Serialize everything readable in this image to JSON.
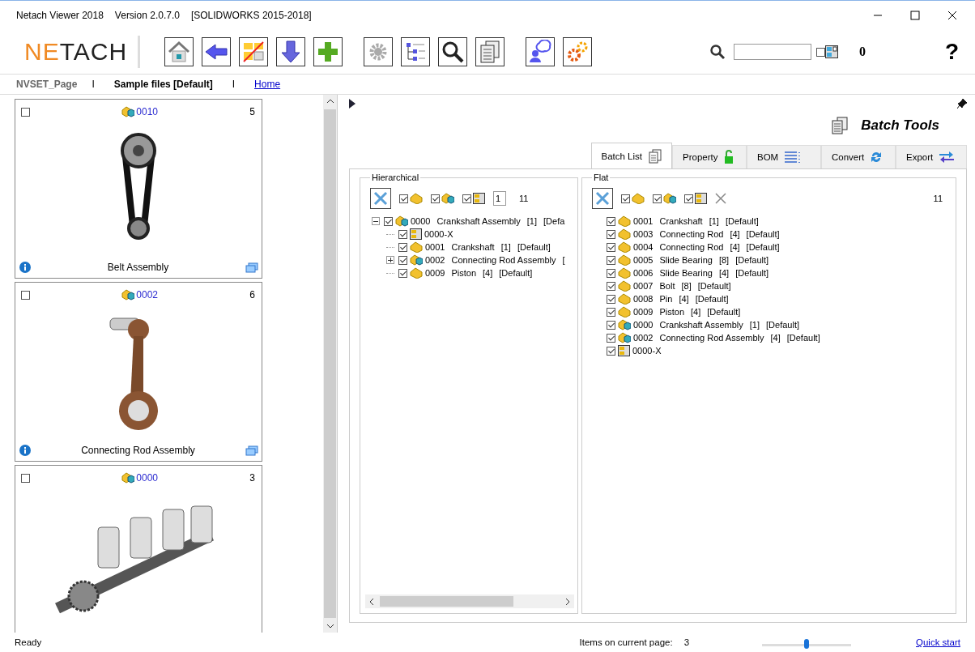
{
  "window": {
    "title": "Netach Viewer 2018",
    "version": "Version 2.0.7.0",
    "platform": "[SOLIDWORKS 2015-2018]"
  },
  "logo": {
    "accent": "NE",
    "rest": "TACH"
  },
  "search": {
    "filter_checked": false,
    "count": "0"
  },
  "help": "?",
  "breadcrumb": {
    "page": "NVSET_Page",
    "separator_1": "I",
    "set": "Sample files [Default]",
    "separator_2": "I",
    "link": "Home"
  },
  "cards": [
    {
      "checked": false,
      "code": "0010",
      "count": "5",
      "title": "Belt Assembly"
    },
    {
      "checked": false,
      "code": "0002",
      "count": "6",
      "title": "Connecting Rod Assembly"
    },
    {
      "checked": false,
      "code": "0000",
      "count": "3"
    }
  ],
  "panel": {
    "title": "Batch Tools"
  },
  "tabs": [
    {
      "label": "Batch List",
      "selected": true
    },
    {
      "label": "Property",
      "selected": false
    },
    {
      "label": "BOM",
      "selected": false
    },
    {
      "label": "Convert",
      "selected": false
    },
    {
      "label": "Export",
      "selected": false
    }
  ],
  "hierarchical": {
    "title": "Hierarchical",
    "filters": [
      {
        "kind": "part",
        "checked": true
      },
      {
        "kind": "assembly",
        "checked": true
      },
      {
        "kind": "drawing",
        "checked": true
      }
    ],
    "level_value": "1",
    "count": "11",
    "tree": [
      {
        "kind": "assembly",
        "checked": true,
        "expanded": true,
        "code": "0000",
        "name": "Crankshaft Assembly",
        "qty": "[1]",
        "config": "[Defa",
        "children": [
          {
            "kind": "drawing",
            "checked": true,
            "code": "0000-X"
          },
          {
            "kind": "part",
            "checked": true,
            "code": "0001",
            "name": "Crankshaft",
            "qty": "[1]",
            "config": "[Default]"
          },
          {
            "kind": "assembly",
            "checked": true,
            "expanded": false,
            "code": "0002",
            "name": "Connecting Rod Assembly",
            "qty": "["
          },
          {
            "kind": "part",
            "checked": true,
            "code": "0009",
            "name": "Piston",
            "qty": "[4]",
            "config": "[Default]"
          }
        ]
      }
    ]
  },
  "flat": {
    "title": "Flat",
    "filters": [
      {
        "kind": "part",
        "checked": true
      },
      {
        "kind": "assembly",
        "checked": true
      },
      {
        "kind": "drawing",
        "checked": true
      }
    ],
    "count": "11",
    "rows": [
      {
        "kind": "part",
        "checked": true,
        "code": "0001",
        "name": "Crankshaft",
        "qty": "[1]",
        "config": "[Default]"
      },
      {
        "kind": "part",
        "checked": true,
        "code": "0003",
        "name": "Connecting Rod",
        "qty": "[4]",
        "config": "[Default]"
      },
      {
        "kind": "part",
        "checked": true,
        "code": "0004",
        "name": "Connecting Rod",
        "qty": "[4]",
        "config": "[Default]"
      },
      {
        "kind": "part",
        "checked": true,
        "code": "0005",
        "name": "Slide Bearing",
        "qty": "[8]",
        "config": "[Default]"
      },
      {
        "kind": "part",
        "checked": true,
        "code": "0006",
        "name": "Slide Bearing",
        "qty": "[4]",
        "config": "[Default]"
      },
      {
        "kind": "part",
        "checked": true,
        "code": "0007",
        "name": "Bolt",
        "qty": "[8]",
        "config": "[Default]"
      },
      {
        "kind": "part",
        "checked": true,
        "code": "0008",
        "name": "Pin",
        "qty": "[4]",
        "config": "[Default]"
      },
      {
        "kind": "part",
        "checked": true,
        "code": "0009",
        "name": "Piston",
        "qty": "[4]",
        "config": "[Default]"
      },
      {
        "kind": "assembly",
        "checked": true,
        "code": "0000",
        "name": "Crankshaft Assembly",
        "qty": "[1]",
        "config": "[Default]"
      },
      {
        "kind": "assembly",
        "checked": true,
        "code": "0002",
        "name": "Connecting Rod Assembly",
        "qty": "[4]",
        "config": "[Default]"
      },
      {
        "kind": "drawing",
        "checked": true,
        "code": "0000-X"
      }
    ]
  },
  "status_bar": {
    "status": "Ready",
    "items_label": "Items on current page:",
    "items_count": "3",
    "zoom": {
      "level": 0.5
    },
    "link": "Quick start"
  }
}
